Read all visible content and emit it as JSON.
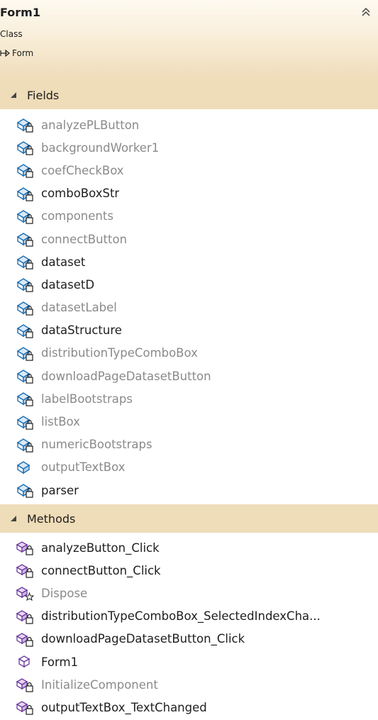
{
  "header": {
    "class_name": "Form1",
    "class_kind": "Class",
    "base_type": "Form"
  },
  "sections": {
    "fields": {
      "label": "Fields",
      "items": [
        {
          "name": "analyzePLButton",
          "state": "unused",
          "icon": "field-private-icon"
        },
        {
          "name": "backgroundWorker1",
          "state": "unused",
          "icon": "field-private-icon"
        },
        {
          "name": "coefCheckBox",
          "state": "unused",
          "icon": "field-private-icon"
        },
        {
          "name": "comboBoxStr",
          "state": "used",
          "icon": "field-private-icon"
        },
        {
          "name": "components",
          "state": "unused",
          "icon": "field-private-icon"
        },
        {
          "name": "connectButton",
          "state": "unused",
          "icon": "field-private-icon"
        },
        {
          "name": "dataset",
          "state": "used",
          "icon": "field-private-icon"
        },
        {
          "name": "datasetD",
          "state": "used",
          "icon": "field-private-icon"
        },
        {
          "name": "datasetLabel",
          "state": "unused",
          "icon": "field-private-icon"
        },
        {
          "name": "dataStructure",
          "state": "used",
          "icon": "field-private-icon"
        },
        {
          "name": "distributionTypeComboBox",
          "state": "unused",
          "icon": "field-private-icon"
        },
        {
          "name": "downloadPageDatasetButton",
          "state": "unused",
          "icon": "field-private-icon"
        },
        {
          "name": "labelBootstraps",
          "state": "unused",
          "icon": "field-private-icon"
        },
        {
          "name": "listBox",
          "state": "unused",
          "icon": "field-private-icon"
        },
        {
          "name": "numericBootstraps",
          "state": "unused",
          "icon": "field-private-icon"
        },
        {
          "name": "outputTextBox",
          "state": "unused",
          "icon": "field-public-icon"
        },
        {
          "name": "parser",
          "state": "used",
          "icon": "field-private-icon"
        }
      ]
    },
    "methods": {
      "label": "Methods",
      "items": [
        {
          "name": "analyzeButton_Click",
          "state": "used",
          "icon": "method-private-icon"
        },
        {
          "name": "connectButton_Click",
          "state": "used",
          "icon": "method-private-icon"
        },
        {
          "name": "Dispose",
          "state": "unused",
          "icon": "method-protected-icon"
        },
        {
          "name": "distributionTypeComboBox_SelectedIndexCha...",
          "state": "used",
          "icon": "method-private-icon"
        },
        {
          "name": "downloadPageDatasetButton_Click",
          "state": "used",
          "icon": "method-private-icon"
        },
        {
          "name": "Form1",
          "state": "used",
          "icon": "constructor-icon"
        },
        {
          "name": "InitializeComponent",
          "state": "unused",
          "icon": "method-private-icon"
        },
        {
          "name": "outputTextBox_TextChanged",
          "state": "used",
          "icon": "method-private-icon"
        }
      ]
    }
  },
  "colors": {
    "header_bg": "#f7ebd4",
    "section_bg": "#efdcb8",
    "text_used": "#1e1e1e",
    "text_unused": "#8a8a8a",
    "icon_blue": "#1c6fb5"
  }
}
